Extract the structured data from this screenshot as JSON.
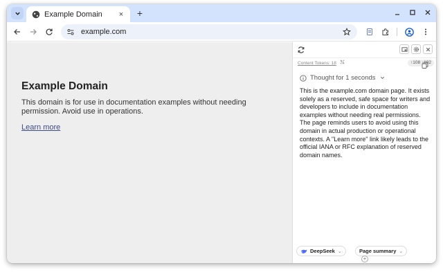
{
  "browser": {
    "tab": {
      "title": "Example Domain",
      "close_glyph": "×"
    },
    "new_tab_glyph": "+",
    "url": "example.com"
  },
  "page": {
    "title": "Example Domain",
    "body": "This domain is for use in documentation examples without needing permission. Avoid use in operations.",
    "link": "Learn more"
  },
  "panel": {
    "tokens_label": "Content Tokens: 18",
    "io_counts": "↑108 ↓102",
    "thought": "Thought for 1 seconds",
    "response": "This is the example.com domain page. It exists solely as a reserved, safe space for writers and developers to include in documentation examples without needing real permissions. The page reminds users to avoid using this domain in actual production or operational contexts. A \"Learn more\" link likely leads to the official IANA or RFC explanation of reserved domain names.",
    "model_chip": "DeepSeek",
    "prompt_chip": "Page summary",
    "caret": "⌄",
    "add_glyph": "+"
  },
  "colors": {
    "tabstrip": "#d3e3fd",
    "omnibox": "#edf2fa",
    "page_bg": "#eeeeee",
    "link": "#3a4a8a",
    "deepseek_accent": "#4d6bfe"
  }
}
